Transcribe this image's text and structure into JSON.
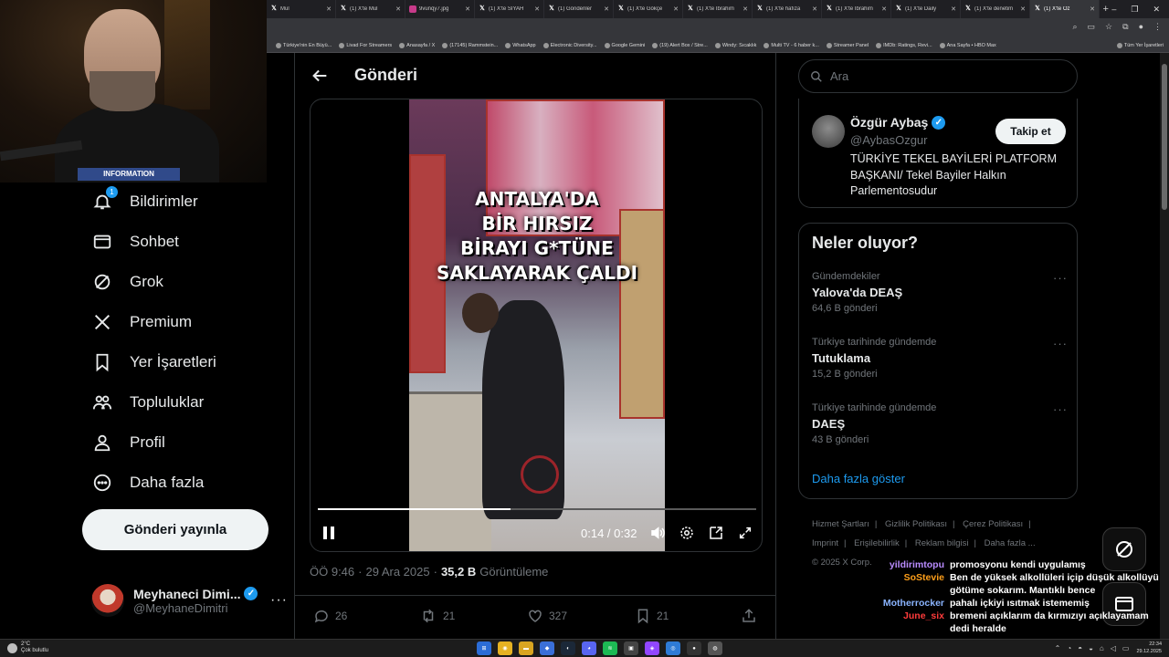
{
  "browser": {
    "tabs": [
      {
        "title": "Mul",
        "fav": "X"
      },
      {
        "title": "(1) X'te Mul",
        "fav": "X"
      },
      {
        "title": "9vunqy7.jpg",
        "fav": "img"
      },
      {
        "title": "(1) X'te SİYAH",
        "fav": "X"
      },
      {
        "title": "(1) Gönderiler",
        "fav": "X"
      },
      {
        "title": "(1) X'te Gökçe",
        "fav": "X"
      },
      {
        "title": "(1) X'te İbrahim",
        "fav": "X"
      },
      {
        "title": "(1) X'te hafıza",
        "fav": "X"
      },
      {
        "title": "(1) X'te İbrahim",
        "fav": "X"
      },
      {
        "title": "(1) X'te Daily",
        "fav": "X"
      },
      {
        "title": "(1) X'te denetim",
        "fav": "X"
      },
      {
        "title": "(1) X'te Öz",
        "fav": "X",
        "active": true
      }
    ],
    "bookmarks": [
      "Türkiye'nin En Büyü...",
      "Livad For Streamers",
      "Anasayfa / X",
      "(17145) Rammstein...",
      "WhatsApp",
      "Electronic Diversity...",
      "Google Gemini",
      "(19) Alert Box / Stre...",
      "Windy: Sıcaklık",
      "Multi TV - 6 haber k...",
      "Streamer Panel",
      "IMDb: Ratings, Revi...",
      "Ana Sayfa • HBO Max"
    ],
    "bookmarks_all": "Tüm Yer İşaretleri"
  },
  "webcam": {
    "shirt_text": "INFORMATION"
  },
  "nav": {
    "items": [
      {
        "label": "Bildirimler",
        "icon": "bell-icon",
        "badge": "1"
      },
      {
        "label": "Sohbet",
        "icon": "mail-icon"
      },
      {
        "label": "Grok",
        "icon": "grok-icon"
      },
      {
        "label": "Premium",
        "icon": "x-logo-icon"
      },
      {
        "label": "Yer İşaretleri",
        "icon": "bookmark-icon"
      },
      {
        "label": "Topluluklar",
        "icon": "people-icon"
      },
      {
        "label": "Profil",
        "icon": "person-icon"
      },
      {
        "label": "Daha fazla",
        "icon": "more-circle-icon"
      }
    ],
    "post_button": "Gönderi yayınla",
    "account": {
      "name": "Meyhaneci Dimi...",
      "handle": "@MeyhaneDimitri"
    }
  },
  "main": {
    "title": "Gönderi",
    "video": {
      "overlay_lines": [
        "ANTALYA'DA",
        "BİR HIRSIZ",
        "BİRAYI G*TÜNE",
        "SAKLAYARAK ÇALDI"
      ],
      "time": "0:14 / 0:32",
      "progress": 0.44
    },
    "meta": {
      "time": "ÖÖ 9:46",
      "date": "29 Ara 2025",
      "views": "35,2 B",
      "views_label": "Görüntüleme"
    },
    "actions": {
      "replies": "26",
      "reposts": "21",
      "likes": "327",
      "bookmarks": "21"
    }
  },
  "sidebar": {
    "search_placeholder": "Ara",
    "profile": {
      "name": "Özgür Aybaş",
      "handle": "@AybasOzgur",
      "follow": "Takip et",
      "bio": "TÜRKİYE TEKEL BAYİLERİ PLATFORM BAŞKANI/ Tekel Bayiler Halkın Parlementosudur"
    },
    "trends_title": "Neler oluyor?",
    "trends": [
      {
        "context": "Gündemdekiler",
        "name": "Yalova'da DEAŞ",
        "count": "64,6 B gönderi"
      },
      {
        "context": "Türkiye tarihinde gündemde",
        "name": "Tutuklama",
        "count": "15,2 B gönderi"
      },
      {
        "context": "Türkiye tarihinde gündemde",
        "name": "DAEŞ",
        "count": "43 B gönderi"
      }
    ],
    "show_more": "Daha fazla göster",
    "footer": [
      "Hizmet Şartları",
      "Gizlilik Politikası",
      "Çerez Politikası",
      "Imprint",
      "Erişilebilirlik",
      "Reklam bilgisi",
      "Daha fazla ...",
      "© 2025 X Corp."
    ]
  },
  "chat": [
    {
      "user": "yildirimtopu",
      "color": "#b98cff",
      "msg": "promosyonu kendi uygulamış"
    },
    {
      "user": "SoStevie",
      "color": "#ff9f1a",
      "msg": "Ben de yüksek alkollüleri içip düşük alkollüyü"
    },
    {
      "user": "",
      "color": "#ffffff",
      "msg": "götüme sokarım. Mantıklı bence"
    },
    {
      "user": "Motherrocker",
      "color": "#8ab4ff",
      "msg": "pahalı içkiyi ısıtmak istememiş"
    },
    {
      "user": "June_six",
      "color": "#ff3b3b",
      "msg": "bremeni açıklarım da kırmızıyı açıklayamam"
    },
    {
      "user": "",
      "color": "#ffffff",
      "msg": "dedi heralde"
    }
  ],
  "taskbar": {
    "weather_temp": "2°C",
    "weather_desc": "Çok bulutlu",
    "time": "22:34",
    "date": "29.12.2025"
  },
  "colors": {
    "accent": "#1d9bf0",
    "background": "#000000",
    "border": "#2f3336",
    "muted": "#71767b"
  }
}
